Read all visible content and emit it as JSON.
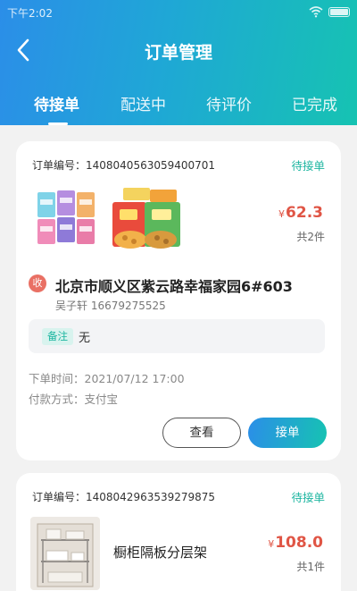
{
  "status_bar": {
    "time": "下午2:02"
  },
  "header": {
    "title": "订单管理"
  },
  "tabs": [
    {
      "label": "待接单"
    },
    {
      "label": "配送中"
    },
    {
      "label": "待评价"
    },
    {
      "label": "已完成"
    }
  ],
  "orders": [
    {
      "order_no": "订单编号：1408040563059400701",
      "status": "待接单",
      "price_symbol": "¥",
      "price": "62.3",
      "count": "共2件",
      "address_badge": "收",
      "address": "北京市顺义区紫云路幸福家园6#603",
      "recipient": "吴子轩 16679275525",
      "note_label": "备注",
      "note": "无",
      "order_time": "下单时间：2021/07/12 17:00",
      "payment": "付款方式：支付宝",
      "view_label": "查看",
      "accept_label": "接单",
      "product_icons": [
        "snack-bags-image",
        "crisp-bags-image"
      ]
    },
    {
      "order_no": "订单编号：1408042963539279875",
      "status": "待接单",
      "product_name": "橱柜隔板分层架",
      "price_symbol": "¥",
      "price": "108.0",
      "count": "共1件",
      "product_icons": [
        "shelf-rack-image"
      ]
    }
  ],
  "colors": {
    "header_gradient_start": "#2b8ee8",
    "header_gradient_end": "#16c3b2",
    "status_text": "#1cb5a0",
    "price": "#e05545",
    "badge": "#e97064"
  }
}
